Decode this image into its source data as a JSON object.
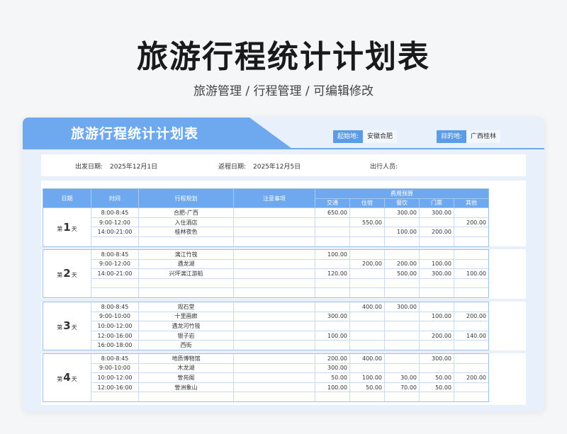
{
  "page": {
    "title": "旅游行程统计计划表",
    "subtitle": "旅游管理 / 行程管理 /  可编辑修改"
  },
  "sheet": {
    "title": "旅游行程统计计划表",
    "origin_label": "起始地:",
    "origin_value": "安徽合肥",
    "dest_label": "目的地:",
    "dest_value": "广西桂林",
    "depart_label": "出发日期:",
    "depart_value": "2025年12月1日",
    "return_label": "返程日期:",
    "return_value": "2025年12月5日",
    "people_label": "出行人员:"
  },
  "table": {
    "headers": {
      "day": "日期",
      "time": "时间",
      "plan": "行程规划",
      "note": "注意事项",
      "budget": "费用预算",
      "transport": "交通",
      "lodging": "住宿",
      "food": "餐饮",
      "ticket": "门票",
      "other": "其他"
    },
    "days": [
      {
        "prefix": "第",
        "num": "1",
        "suffix": "天",
        "rows": [
          {
            "time": "8:00-8:45",
            "plan": "合肥-广西",
            "transport": "650.00",
            "lodging": "",
            "food": "300.00",
            "ticket": "300.00",
            "other": ""
          },
          {
            "time": "9:00-12:00",
            "plan": "入住酒店",
            "transport": "",
            "lodging": "550.00",
            "food": "",
            "ticket": "",
            "other": "200.00"
          },
          {
            "time": "14:00-21:00",
            "plan": "桂林夜色",
            "transport": "",
            "lodging": "",
            "food": "100.00",
            "ticket": "200.00",
            "other": ""
          },
          {
            "time": "",
            "plan": "",
            "transport": "",
            "lodging": "",
            "food": "",
            "ticket": "",
            "other": ""
          }
        ]
      },
      {
        "prefix": "第",
        "num": "2",
        "suffix": "天",
        "rows": [
          {
            "time": "8:00-8:45",
            "plan": "漓江竹筏",
            "transport": "100.00",
            "lodging": "",
            "food": "",
            "ticket": "",
            "other": ""
          },
          {
            "time": "9:00-12:00",
            "plan": "遇龙湖",
            "transport": "",
            "lodging": "200.00",
            "food": "200.00",
            "ticket": "100.00",
            "other": ""
          },
          {
            "time": "14:00-21:00",
            "plan": "兴坪漓江游船",
            "transport": "120.00",
            "lodging": "",
            "food": "500.00",
            "ticket": "300.00",
            "other": "100.00"
          },
          {
            "time": "",
            "plan": "",
            "transport": "",
            "lodging": "",
            "food": "",
            "ticket": "",
            "other": ""
          },
          {
            "time": "",
            "plan": "",
            "transport": "",
            "lodging": "",
            "food": "",
            "ticket": "",
            "other": ""
          }
        ]
      },
      {
        "prefix": "第",
        "num": "3",
        "suffix": "天",
        "rows": [
          {
            "time": "8:00-8:45",
            "plan": "观石堂",
            "transport": "",
            "lodging": "400.00",
            "food": "300.00",
            "ticket": "",
            "other": ""
          },
          {
            "time": "9:00-10:00",
            "plan": "十里画廊",
            "transport": "300.00",
            "lodging": "",
            "food": "",
            "ticket": "100.00",
            "other": "200.00"
          },
          {
            "time": "10:00-12:00",
            "plan": "遇龙河竹筏",
            "transport": "",
            "lodging": "",
            "food": "",
            "ticket": "",
            "other": ""
          },
          {
            "time": "12:00-16:00",
            "plan": "银子岩",
            "transport": "100.00",
            "lodging": "",
            "food": "",
            "ticket": "200.00",
            "other": "140.00"
          },
          {
            "time": "16:00-18:00",
            "plan": "西街",
            "transport": "",
            "lodging": "",
            "food": "",
            "ticket": "",
            "other": ""
          }
        ]
      },
      {
        "prefix": "第",
        "num": "4",
        "suffix": "天",
        "rows": [
          {
            "time": "8:00-8:45",
            "plan": "地质博物馆",
            "transport": "200.00",
            "lodging": "400.00",
            "food": "",
            "ticket": "300.00",
            "other": ""
          },
          {
            "time": "9:00-10:00",
            "plan": "木龙湖",
            "transport": "300.00",
            "lodging": "",
            "food": "",
            "ticket": "",
            "other": ""
          },
          {
            "time": "10:00-12:00",
            "plan": "訾苑阁",
            "transport": "50.00",
            "lodging": "100.00",
            "food": "30.00",
            "ticket": "50.00",
            "other": "200.00"
          },
          {
            "time": "12:00-16:00",
            "plan": "訾洲象山",
            "transport": "100.00",
            "lodging": "50.00",
            "food": "70.00",
            "ticket": "50.00",
            "other": ""
          },
          {
            "time": "",
            "plan": "",
            "transport": "",
            "lodging": "",
            "food": "",
            "ticket": "",
            "other": ""
          }
        ]
      }
    ]
  },
  "colors": {
    "accent": "#6ea8ee",
    "card_bg": "#e7f0fb",
    "border": "#c8dbf2"
  }
}
